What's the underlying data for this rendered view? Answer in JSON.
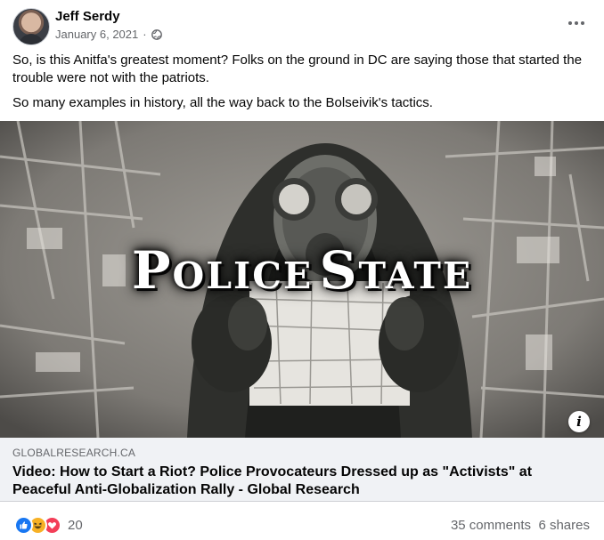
{
  "post": {
    "author": "Jeff Serdy",
    "date": "January 6, 2021",
    "separator": "·",
    "privacy_icon": "globe-icon",
    "more_icon": "more-horizontal-icon",
    "paragraphs": [
      "So, is this Anitfa's greatest moment? Folks on the ground in DC are saying those that started the trouble were not with the patriots.",
      "So many examples in history, all the way back to the Bolseivik's tactics."
    ]
  },
  "link_preview": {
    "image_headline_word1": "Police",
    "image_headline_word2": "State",
    "info_icon": "info-icon",
    "info_glyph": "i",
    "domain": "GLOBALRESEARCH.CA",
    "title": "Video: How to Start a Riot? Police Provocateurs Dressed up as \"Activists\" at Peaceful Anti-Globalization Rally - Global Research"
  },
  "stats": {
    "reaction_icons": [
      "like-icon",
      "haha-icon",
      "love-icon"
    ],
    "reaction_count": "20",
    "comments": "35 comments",
    "shares": "6 shares"
  },
  "colors": {
    "secondary_text": "#65676b",
    "link_footer_bg": "#f0f2f5",
    "like_blue": "#1877f2",
    "haha_yellow": "#f7b125",
    "love_red": "#f33e58"
  }
}
